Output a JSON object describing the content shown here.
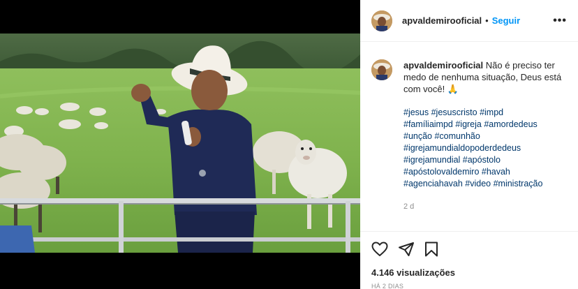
{
  "post": {
    "username": "apvaldemirooficial",
    "follow_label": "Seguir",
    "dot": "•",
    "more_label": "•••"
  },
  "caption": {
    "username": "apvaldemirooficial",
    "text": "Não é preciso ter medo de nenhuma situação, Deus está com você! 🙏",
    "hashtags_line1": "#jesus #jesuscristo #impd",
    "hashtags_line2": "#famíliaimpd #igreja #amordedeus",
    "hashtags_line3": "#unção #comunhão",
    "hashtags_line4": "#igrejamundialdopoderdedeus",
    "hashtags_line5": "#igrejamundial #apóstolo",
    "hashtags_line6": "#apóstolovaldemiro #havah",
    "hashtags_line7": "#agenciahavah #video #ministração",
    "time_ago": "2 d"
  },
  "stats": {
    "views": "4.146 visualizações",
    "date": "HÁ 2 DIAS"
  },
  "icons": [
    "heart-icon",
    "share-icon",
    "bookmark-icon",
    "more-icon"
  ],
  "colors": {
    "link_blue": "#0095f6",
    "hashtag_blue": "#00376b",
    "text": "#262626",
    "muted": "#8e8e8e",
    "border": "#efefef"
  }
}
